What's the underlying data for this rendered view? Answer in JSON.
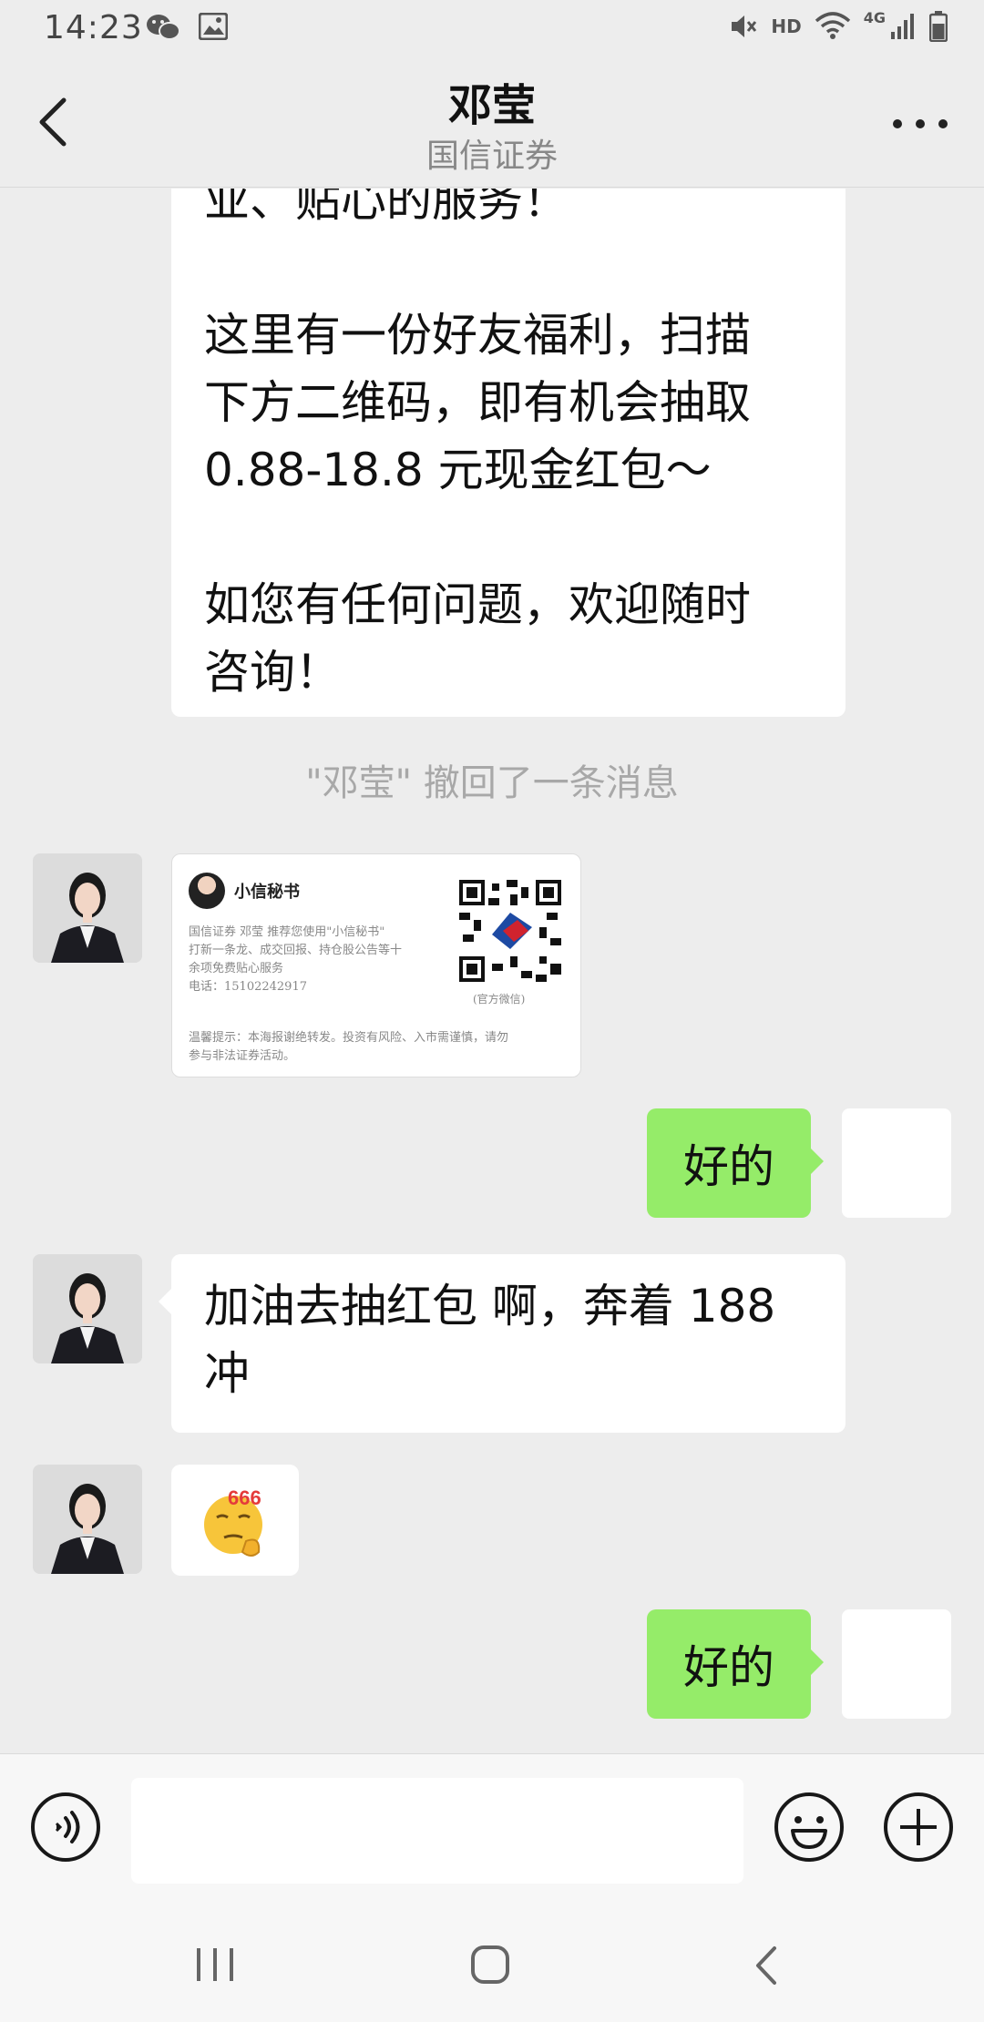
{
  "status_bar": {
    "time": "14:23",
    "hd": "HD",
    "network": "4G",
    "icons": [
      "wechat-icon",
      "gallery-icon",
      "mute-icon",
      "wifi-icon",
      "signal-icon",
      "battery-icon"
    ]
  },
  "header": {
    "title": "邓莹",
    "subtitle": "国信证券"
  },
  "messages": {
    "top_text_lines": [
      "业、贴心的服务！",
      "",
      "这里有一份好友福利，扫描",
      "下方二维码，即有机会抽取",
      "0.88-18.8 元现金红包～",
      "",
      "如您有任何问题，欢迎随时",
      "咨询！"
    ],
    "recall_notice": "\"邓莹\" 撤回了一条消息",
    "card": {
      "name": "小信秘书",
      "line1": "国信证券 邓莹 推荐您使用\"小信秘书\"",
      "line2": "打新一条龙、成交回报、持仓股公告等十",
      "line3": "余项免费贴心服务",
      "line4": "电话：15102242917",
      "qr_caption": "(官方微信)",
      "notice1": "温馨提示：本海报谢绝转发。投资有风险、入市需谨慎，请勿",
      "notice2": "参与非法证券活动。"
    },
    "reply1": "好的",
    "msg_line1": "加油去抽红包 啊，奔着 188",
    "msg_line2": "冲",
    "sticker_text": "666",
    "reply2": "好的"
  },
  "colors": {
    "background": "#EDEDED",
    "green_bubble": "#95EC69",
    "white_bubble": "#FFFFFF"
  }
}
